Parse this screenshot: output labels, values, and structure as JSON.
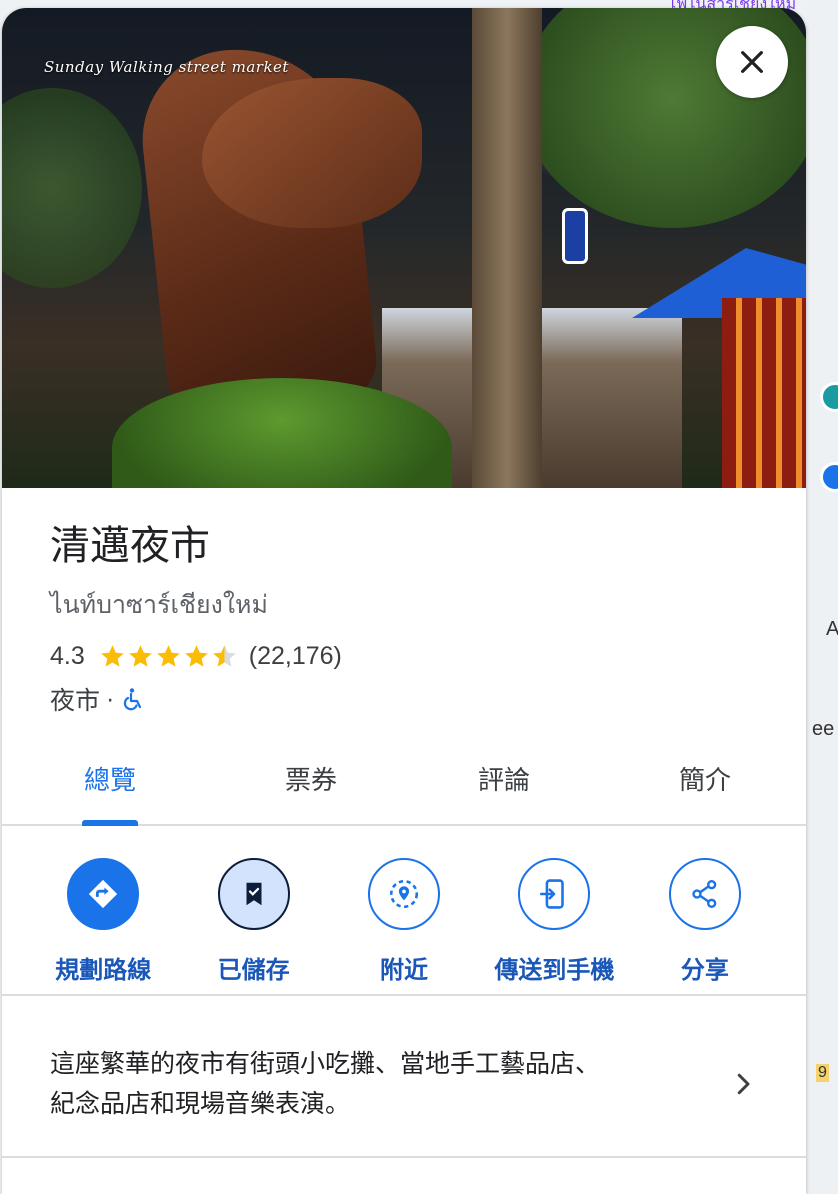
{
  "map": {
    "top_label": "ไฟไนส์ารเชียงใหม่",
    "side_label_a": "A",
    "side_label_ee": "ee",
    "side_label_9": "9"
  },
  "hero": {
    "caption": "Sunday Walking street market"
  },
  "place": {
    "title": "清邁夜市",
    "subtitle": "ไนท์บาซาร์เชียงใหม่",
    "rating": "4.3",
    "stars": 4.5,
    "review_count": "(22,176)",
    "category": "夜市",
    "separator": "·"
  },
  "tabs": [
    {
      "label": "總覽",
      "active": true
    },
    {
      "label": "票券",
      "active": false
    },
    {
      "label": "評論",
      "active": false
    },
    {
      "label": "簡介",
      "active": false
    }
  ],
  "actions": [
    {
      "label": "規劃路線",
      "icon": "directions-icon"
    },
    {
      "label": "已儲存",
      "icon": "bookmark-check-icon"
    },
    {
      "label": "附近",
      "icon": "nearby-icon"
    },
    {
      "label": "傳送到手機",
      "icon": "send-to-phone-icon"
    },
    {
      "label": "分享",
      "icon": "share-icon"
    }
  ],
  "description": {
    "text_line1": "這座繁華的夜市有街頭小吃攤、當地手工藝品店、",
    "text_line2": "紀念品店和現場音樂表演。"
  },
  "colors": {
    "accent": "#1a73e8",
    "star": "#fbbc04",
    "text": "#202124"
  }
}
